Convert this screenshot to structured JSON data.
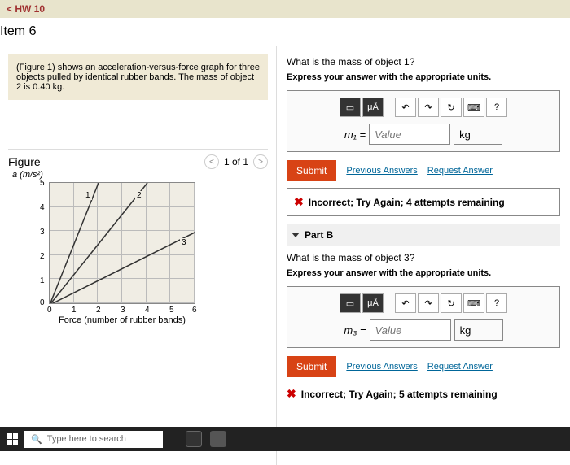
{
  "nav": {
    "back": "< HW 10"
  },
  "item": {
    "title": "Item 6"
  },
  "problem": {
    "text": "(Figure 1) shows an acceleration-versus-force graph for three objects pulled by identical rubber bands. The mass of object 2 is 0.40 kg."
  },
  "figure": {
    "title": "Figure",
    "nav_text": "1 of 1",
    "y_axis": "a (m/s²)",
    "x_axis": "Force (number of rubber bands)",
    "y_ticks": [
      "5",
      "4",
      "3",
      "2",
      "1",
      "0"
    ],
    "x_ticks": [
      "0",
      "1",
      "2",
      "3",
      "4",
      "5",
      "6"
    ],
    "line_labels": {
      "l1": "1",
      "l2": "2",
      "l3": "3"
    }
  },
  "partA": {
    "question": "What is the mass of object 1?",
    "instruction": "Express your answer with the appropriate units.",
    "var": "m₁ =",
    "placeholder": "Value",
    "unit": "kg",
    "submit": "Submit",
    "prev": "Previous Answers",
    "request": "Request Answer",
    "feedback": "Incorrect; Try Again; 4 attempts remaining",
    "toolbar": {
      "mu": "μÅ",
      "help": "?"
    }
  },
  "partB": {
    "title": "Part B",
    "question": "What is the mass of object 3?",
    "instruction": "Express your answer with the appropriate units.",
    "var": "m₃ =",
    "placeholder": "Value",
    "unit": "kg",
    "submit": "Submit",
    "prev": "Previous Answers",
    "request": "Request Answer",
    "feedback": "Incorrect; Try Again; 5 attempts remaining",
    "toolbar": {
      "mu": "μÅ",
      "help": "?"
    }
  },
  "taskbar": {
    "search": "Type here to search"
  },
  "chart_data": {
    "type": "line",
    "title": "acceleration vs force",
    "xlabel": "Force (number of rubber bands)",
    "ylabel": "a (m/s²)",
    "xlim": [
      0,
      6
    ],
    "ylim": [
      0,
      5
    ],
    "series": [
      {
        "name": "1",
        "x": [
          0,
          2
        ],
        "y": [
          0,
          5
        ]
      },
      {
        "name": "2",
        "x": [
          0,
          4
        ],
        "y": [
          0,
          5
        ]
      },
      {
        "name": "3",
        "x": [
          0,
          6
        ],
        "y": [
          0,
          3
        ]
      }
    ],
    "annotations": [
      {
        "series": "1",
        "label": "1"
      },
      {
        "series": "2",
        "label": "2"
      },
      {
        "series": "3",
        "label": "3"
      }
    ]
  }
}
